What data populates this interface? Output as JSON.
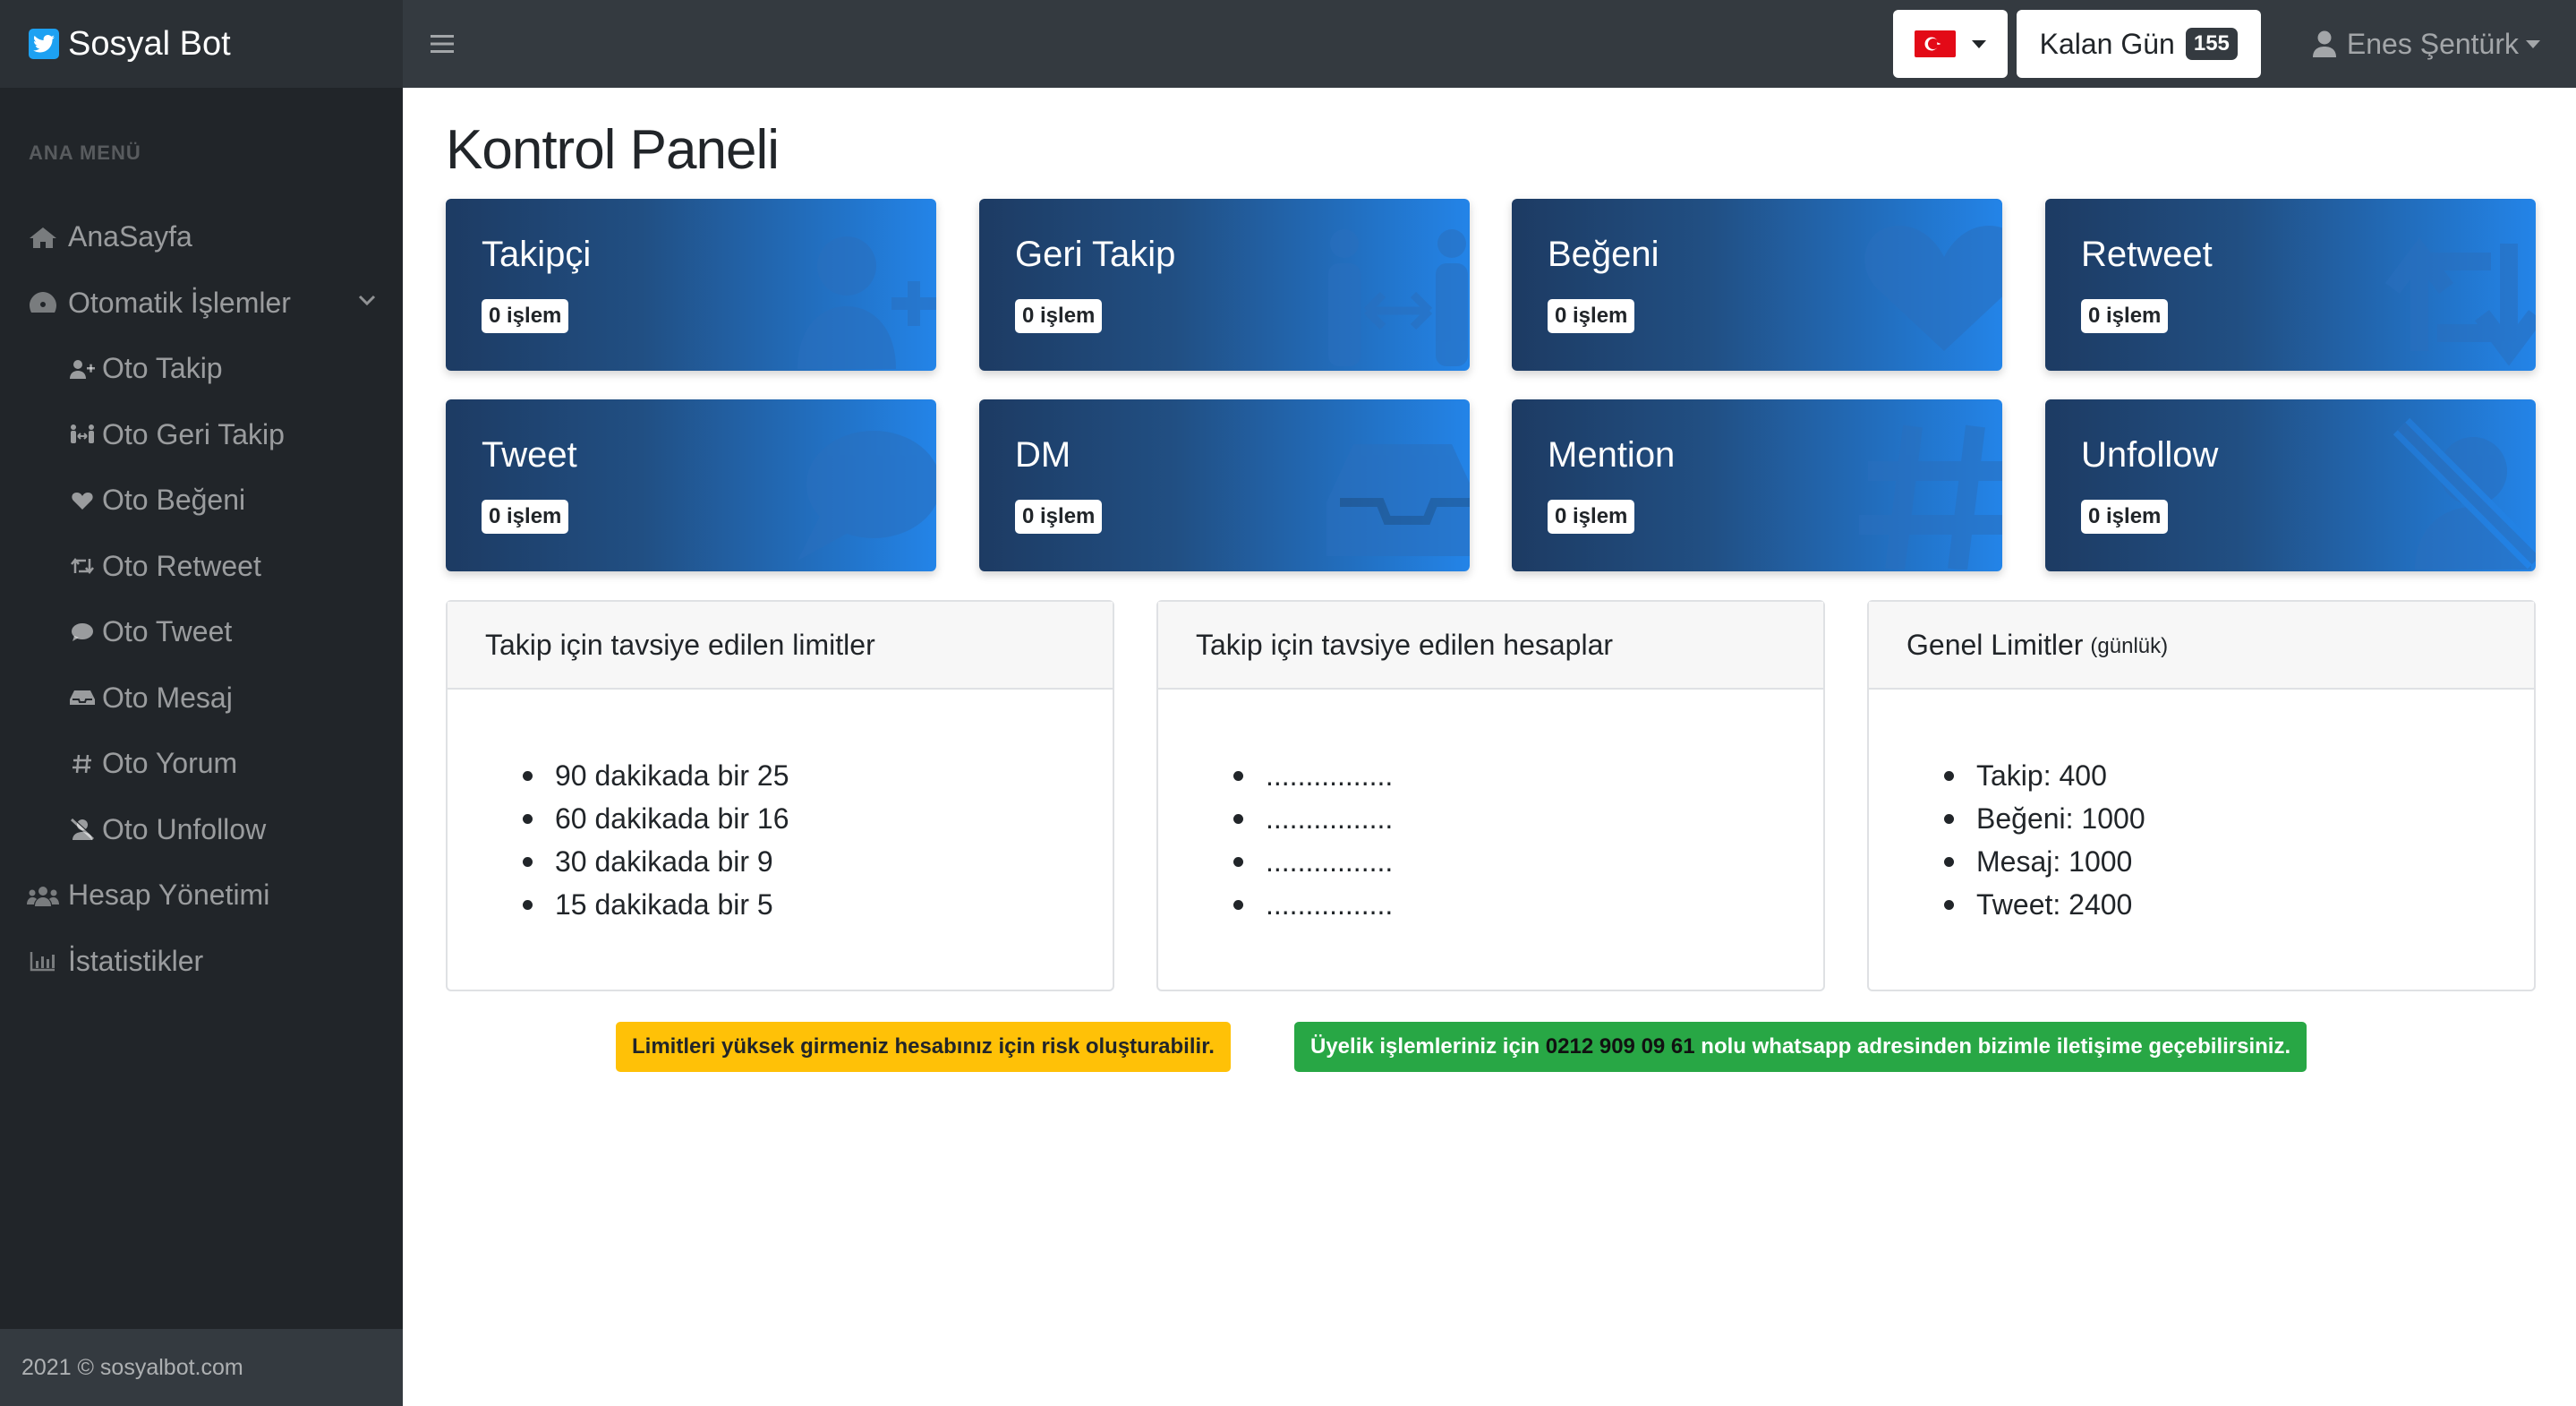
{
  "brand": {
    "name": "Sosyal Bot"
  },
  "topbar": {
    "days_label": "Kalan Gün",
    "days_value": "155",
    "user_name": "Enes Şentürk"
  },
  "sidebar": {
    "heading": "ANA MENÜ",
    "items": [
      {
        "label": "AnaSayfa"
      },
      {
        "label": "Otomatik İşlemler"
      },
      {
        "label": "Oto Takip"
      },
      {
        "label": "Oto Geri Takip"
      },
      {
        "label": "Oto Beğeni"
      },
      {
        "label": "Oto Retweet"
      },
      {
        "label": "Oto Tweet"
      },
      {
        "label": "Oto Mesaj"
      },
      {
        "label": "Oto Yorum"
      },
      {
        "label": "Oto Unfollow"
      },
      {
        "label": "Hesap Yönetimi"
      },
      {
        "label": "İstatistikler"
      }
    ],
    "footer": "2021 © sosyalbot.com"
  },
  "main": {
    "title": "Kontrol Paneli",
    "cards": [
      {
        "title": "Takipçi",
        "badge": "0 işlem"
      },
      {
        "title": "Geri Takip",
        "badge": "0 işlem"
      },
      {
        "title": "Beğeni",
        "badge": "0 işlem"
      },
      {
        "title": "Retweet",
        "badge": "0 işlem"
      },
      {
        "title": "Tweet",
        "badge": "0 işlem"
      },
      {
        "title": "DM",
        "badge": "0 işlem"
      },
      {
        "title": "Mention",
        "badge": "0 işlem"
      },
      {
        "title": "Unfollow",
        "badge": "0 işlem"
      }
    ],
    "panels": [
      {
        "title": "Takip için tavsiye edilen limitler",
        "items": [
          "90 dakikada bir 25",
          "60 dakikada bir 16",
          "30 dakikada bir 9",
          "15 dakikada bir 5"
        ]
      },
      {
        "title": "Takip için tavsiye edilen hesaplar",
        "items": [
          "................",
          "................",
          "................",
          "................"
        ]
      },
      {
        "title": "Genel Limitler",
        "subtitle": "(günlük)",
        "items": [
          "Takip: 400",
          "Beğeni: 1000",
          "Mesaj: 1000",
          "Tweet: 2400"
        ]
      }
    ],
    "alerts": {
      "warning": "Limitleri yüksek girmeniz hesabınız için risk oluşturabilir.",
      "info_prefix": "Üyelik işlemleriniz için",
      "phone": "0212 909 09 61",
      "info_suffix": "nolu whatsapp adresinden bizimle iletişime geçebilirsiniz."
    }
  },
  "colors": {
    "navbar": "#343a40",
    "sidebar": "#212529",
    "card_start": "#1d3b63",
    "card_end": "#2384e8",
    "warning": "#ffc107",
    "success": "#28a745"
  }
}
